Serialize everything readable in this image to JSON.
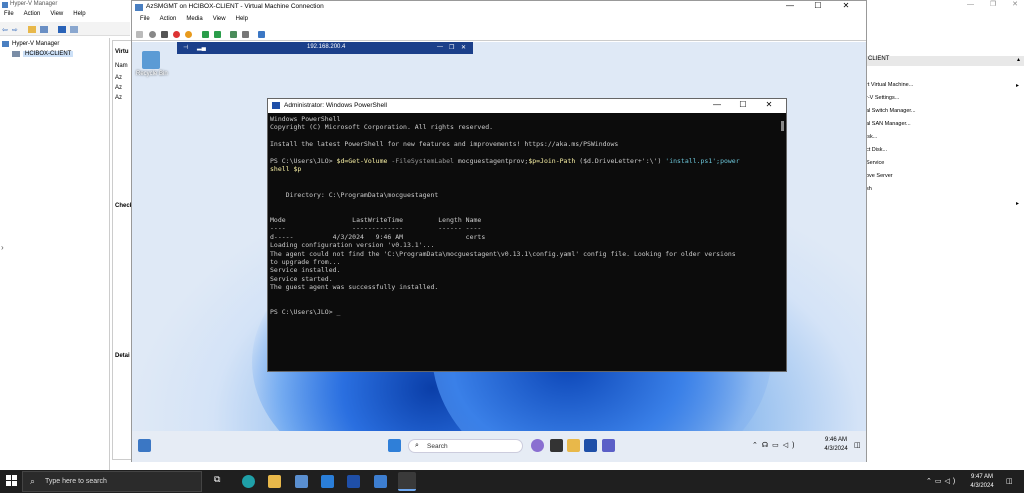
{
  "hyperv": {
    "title": "Hyper-V Manager",
    "menu": [
      "File",
      "Action",
      "View",
      "Help"
    ],
    "tree_root": "Hyper-V Manager",
    "tree_child": "HCIBOX-CLIENT",
    "center_header": "Virtu",
    "center_name_col": "Nam",
    "vm_rows": [
      "Az",
      "Az",
      "Az"
    ],
    "checkpoints_label": "Check",
    "details_label": "Detai",
    "status_text": "",
    "actions_header": "CLIENT",
    "actions": [
      "rt Virtual Machine...",
      "r-V Settings...",
      "al Switch Manager...",
      "al SAN Manager...",
      "isk...",
      "ct Disk...",
      "Service",
      "ove Server",
      "sh"
    ]
  },
  "vm_window": {
    "title": "AzSMGMT on HCIBOX-CLIENT - Virtual Machine Connection",
    "menu": [
      "File",
      "Action",
      "Media",
      "View",
      "Help"
    ],
    "minimize": "—",
    "maximize": "☐",
    "close": "✕"
  },
  "guest": {
    "rdp_ip": "192.168.200.4",
    "recycle_bin": "Recycle Bin",
    "search_placeholder": "Search",
    "time": "9:46 AM",
    "date": "4/3/2024"
  },
  "powershell": {
    "title": "Administrator: Windows PowerShell",
    "lines": {
      "l1": "Windows PowerShell",
      "l2": "Copyright (C) Microsoft Corporation. All rights reserved.",
      "l3": "",
      "l4": "Install the latest PowerShell for new features and improvements! https://aka.ms/PSWindows",
      "l5": "",
      "prompt1": "PS C:\\Users\\JLO> ",
      "cmd_a": "$d=Get-Volume ",
      "cmd_b": "-FileSystemLabel ",
      "cmd_c": "mocguestagentprov;",
      "cmd_d": "$p=Join-Path ",
      "cmd_e": "($d.DriveLetter+':\\') ",
      "cmd_f": "'install.ps1';power",
      "cmd_g": "shell $p",
      "l7": "",
      "l8": "",
      "l9": "    Directory: C:\\ProgramData\\mocguestagent",
      "l10": "",
      "l11": "",
      "l12": "Mode                 LastWriteTime         Length Name",
      "l13": "----                 -------------         ------ ----",
      "l14": "d-----          4/3/2024   9:46 AM                certs",
      "l15": "Loading configuration version 'v0.13.1'...",
      "l16": "The agent could not find the 'C:\\ProgramData\\mocguestagent\\v0.13.1\\config.yaml' config file. Looking for older versions",
      "l17": "to upgrade from...",
      "l18": "Service installed.",
      "l19": "Service started.",
      "l20": "The guest agent was successfully installed.",
      "l21": "",
      "l22": "",
      "prompt2": "PS C:\\Users\\JLO> ",
      "cursor": "_"
    }
  },
  "host_taskbar": {
    "search_placeholder": "Type here to search",
    "time": "9:47 AM",
    "date": "4/3/2024"
  },
  "colors": {
    "ps_background": "#0c0c0c",
    "ps_text": "#cccccc",
    "ps_command": "#f9f1a5",
    "ps_param": "#9a9a9a",
    "ps_string": "#6cc6d9",
    "host_taskbar": "#1f1f1f"
  }
}
